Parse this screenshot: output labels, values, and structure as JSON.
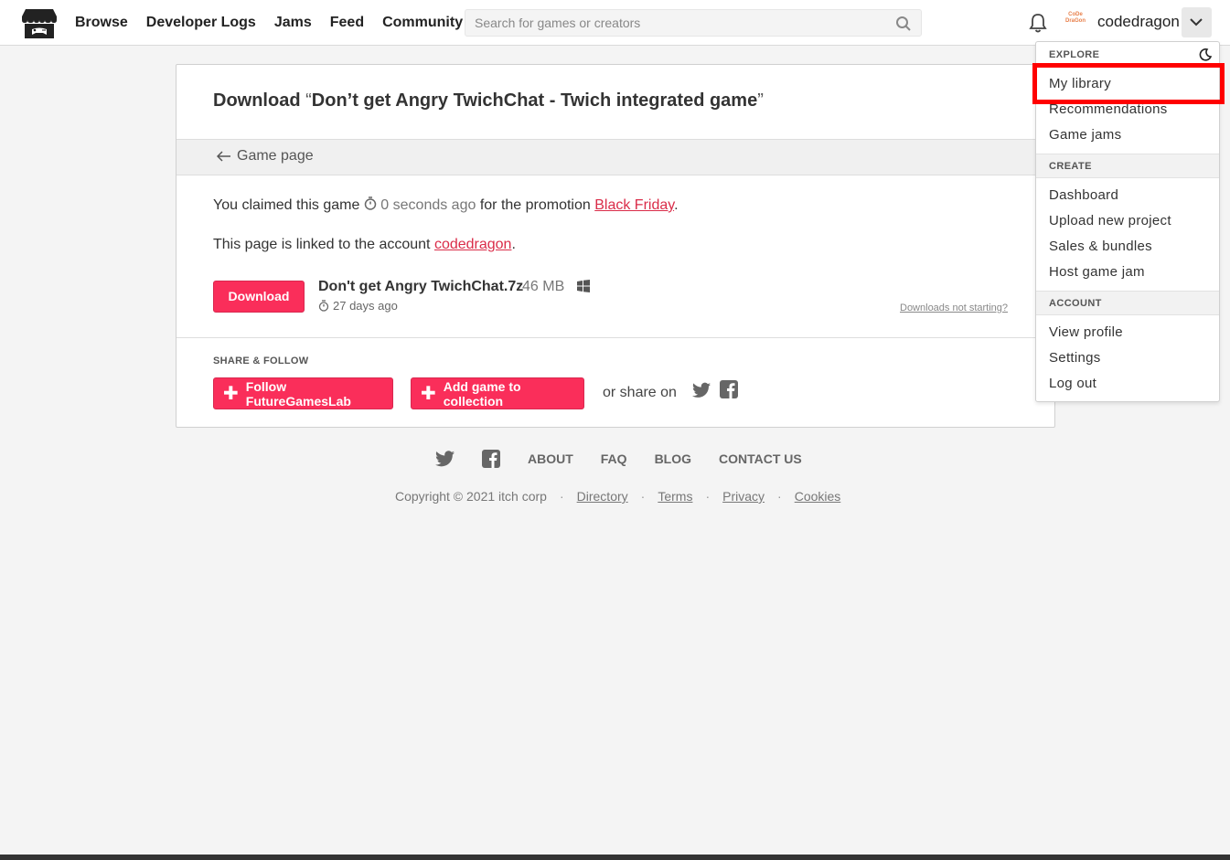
{
  "header": {
    "nav": [
      "Browse",
      "Developer Logs",
      "Jams",
      "Feed",
      "Community"
    ],
    "search_placeholder": "Search for games or creators",
    "avatar_text": "CoDe DraGon",
    "username": "codedragon"
  },
  "card": {
    "title_prefix": "Download",
    "quote_open": "“",
    "title_game": "Don’t get Angry TwichChat - Twich integrated game",
    "quote_close": "”",
    "back_link": "Game page",
    "claimed_prefix": "You claimed this game",
    "claimed_time": "0 seconds ago",
    "claimed_mid": "for the promotion",
    "promotion": "Black Friday",
    "period": ".",
    "linked_prefix": "This page is linked to the account",
    "account": "codedragon",
    "download_label": "Download",
    "file_name": "Don't get Angry TwichChat.7z",
    "file_size": "46 MB",
    "file_date": "27 days ago",
    "not_starting": "Downloads not starting?",
    "share_label": "SHARE & FOLLOW",
    "follow_label": "Follow FutureGamesLab",
    "collection_label": "Add game to collection",
    "share_on": "or share on"
  },
  "footer": {
    "links": [
      "ABOUT",
      "FAQ",
      "BLOG",
      "CONTACT US"
    ],
    "copyright": "Copyright © 2021 itch corp",
    "legal": [
      "Directory",
      "Terms",
      "Privacy",
      "Cookies"
    ]
  },
  "dropdown": {
    "explore_header": "EXPLORE",
    "explore_items": [
      "My library",
      "Recommendations",
      "Game jams"
    ],
    "create_header": "CREATE",
    "create_items": [
      "Dashboard",
      "Upload new project",
      "Sales & bundles",
      "Host game jam"
    ],
    "account_header": "ACCOUNT",
    "account_items": [
      "View profile",
      "Settings",
      "Log out"
    ]
  },
  "colors": {
    "accent": "#fa2e5a",
    "link": "#da2c49",
    "highlight": "#ff0000"
  }
}
